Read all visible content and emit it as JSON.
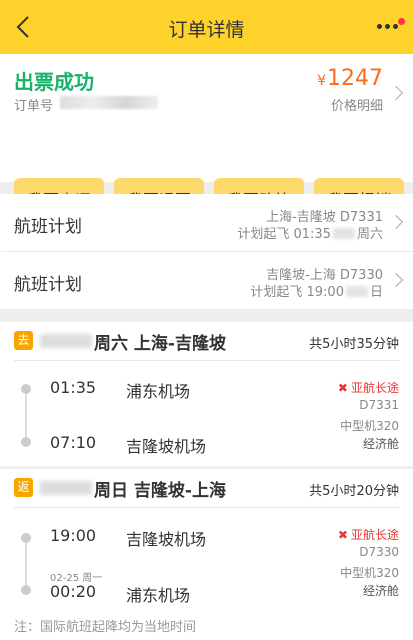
{
  "header": {
    "title": "订单详情"
  },
  "status": {
    "title": "出票成功",
    "order_label": "订单号",
    "currency": "¥",
    "price": "1247",
    "price_detail": "价格明细"
  },
  "actions": [
    {
      "label": "我要点评"
    },
    {
      "label": "我要退票"
    },
    {
      "label": "我要改签"
    },
    {
      "label": "我要报销"
    }
  ],
  "flight_plans": [
    {
      "label": "航班计划",
      "route": "上海-吉隆坡 D7331",
      "time_prefix": "计划起飞 01:35",
      "time_suffix": "周六"
    },
    {
      "label": "航班计划",
      "route": "吉隆坡-上海 D7330",
      "time_prefix": "计划起飞 19:00",
      "time_suffix": "日"
    }
  ],
  "segments": [
    {
      "tag": "去",
      "title": "周六 上海-吉隆坡",
      "duration": "共5小时35分钟",
      "dep_time": "01:35",
      "dep_airport": "浦东机场",
      "arr_time": "07:10",
      "arr_airport": "吉隆坡机场",
      "arr_date": "",
      "airline": "亚航长途",
      "flight_no": "D7331",
      "aircraft": "中型机320",
      "cabin": "经济舱"
    },
    {
      "tag": "返",
      "title": "周日 吉隆坡-上海",
      "duration": "共5小时20分钟",
      "dep_time": "19:00",
      "dep_airport": "吉隆坡机场",
      "arr_time": "00:20",
      "arr_airport": "浦东机场",
      "arr_date": "02-25 周一",
      "airline": "亚航长途",
      "flight_no": "D7330",
      "aircraft": "中型机320",
      "cabin": "经济舱"
    }
  ],
  "note": "注：国际航班起降均为当地时间",
  "colors": {
    "header": "#fdd22a",
    "success": "#19b26a",
    "price": "#f76d1d",
    "button": "#fdd86b",
    "tag": "#f7a600",
    "airline": "#e53935"
  }
}
